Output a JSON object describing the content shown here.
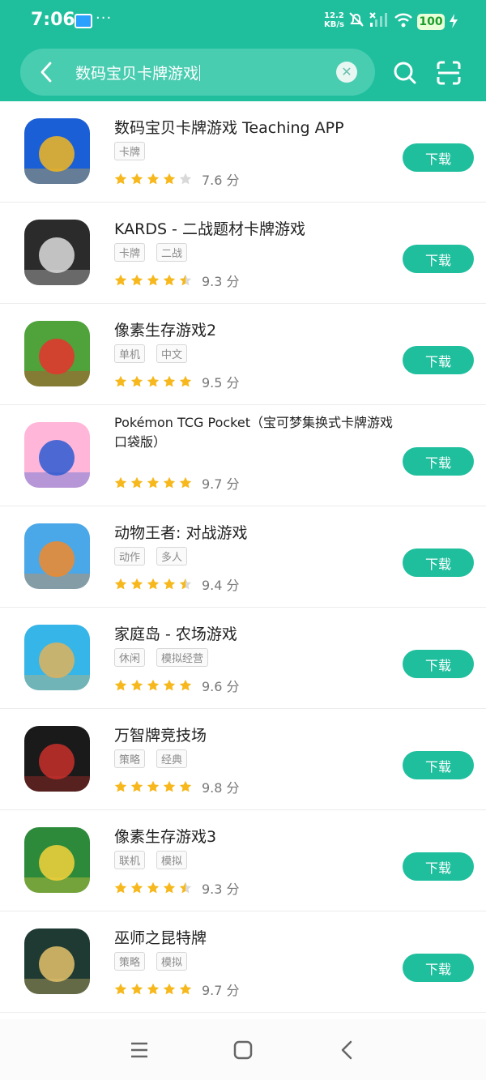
{
  "status": {
    "time": "7:06",
    "speed_value": "12.2",
    "speed_unit": "KB/s",
    "battery": "100",
    "notification_dots": "···"
  },
  "search": {
    "query": "数码宝贝卡牌游戏",
    "clear_label": "✕"
  },
  "results": [
    {
      "title": "数码宝贝卡牌游戏 Teaching APP",
      "tags": [
        "卡牌"
      ],
      "stars": 4,
      "score": "7.6 分",
      "action": "下载",
      "icon": "digimon-icon",
      "colors": [
        "#1b5fd6",
        "#f2b620"
      ]
    },
    {
      "title": "KARDS - 二战题材卡牌游戏",
      "tags": [
        "卡牌",
        "二战"
      ],
      "stars": 4.5,
      "score": "9.3 分",
      "action": "下载",
      "icon": "kards-star-icon",
      "colors": [
        "#2b2b2b",
        "#dddddd"
      ]
    },
    {
      "title": "像素生存游戏2",
      "tags": [
        "单机",
        "中文"
      ],
      "stars": 5,
      "score": "9.5 分",
      "action": "下载",
      "icon": "pixel-survival-2-icon",
      "colors": [
        "#4fa33a",
        "#e7332e"
      ]
    },
    {
      "title": "Pokémon TCG Pocket（宝可梦集换式卡牌游戏口袋版）",
      "tags": [],
      "stars": 5,
      "score": "9.7 分",
      "action": "下载",
      "icon": "pokemon-card-icon",
      "colors": [
        "#ffb6d9",
        "#2d5bd1"
      ]
    },
    {
      "title": "动物王者: 对战游戏",
      "tags": [
        "动作",
        "多人"
      ],
      "stars": 4.5,
      "score": "9.4 分",
      "action": "下载",
      "icon": "zooba-fox-icon",
      "colors": [
        "#4aa7e8",
        "#f28a2a"
      ]
    },
    {
      "title": "家庭岛 - 农场游戏",
      "tags": [
        "休闲",
        "模拟经营"
      ],
      "stars": 5,
      "score": "9.6 分",
      "action": "下载",
      "icon": "family-island-icon",
      "colors": [
        "#35b5e8",
        "#e0b35b"
      ]
    },
    {
      "title": "万智牌竞技场",
      "tags": [
        "策略",
        "经典"
      ],
      "stars": 5,
      "score": "9.8 分",
      "action": "下载",
      "icon": "mtg-arena-icon",
      "colors": [
        "#1a1a1a",
        "#c9302c"
      ]
    },
    {
      "title": "像素生存游戏3",
      "tags": [
        "联机",
        "模拟"
      ],
      "stars": 4.5,
      "score": "9.3 分",
      "action": "下载",
      "icon": "pixel-survival-3-icon",
      "colors": [
        "#2d8a3a",
        "#f6d23c"
      ]
    },
    {
      "title": "巫师之昆特牌",
      "tags": [
        "策略",
        "模拟"
      ],
      "stars": 5,
      "score": "9.7 分",
      "action": "下载",
      "icon": "gwent-crown-icon",
      "colors": [
        "#1f3a33",
        "#e4c26a"
      ]
    }
  ],
  "icons": {
    "back": "back-arrow-icon",
    "search": "search-icon",
    "scan": "scan-icon",
    "nav_menu": "menu-icon",
    "nav_home": "home-icon",
    "nav_back": "nav-back-icon"
  },
  "colors": {
    "accent": "#1fbf9e",
    "star": "#f6b81c",
    "star_empty": "#d9d9d9"
  }
}
